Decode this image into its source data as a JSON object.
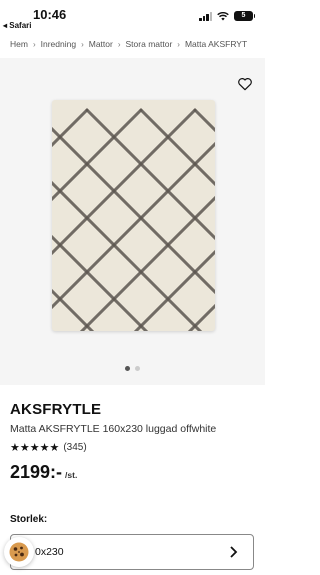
{
  "status_bar": {
    "time": "10:46",
    "back_app": "◂ Safari",
    "battery": "5"
  },
  "breadcrumb": [
    "Hem",
    "Inredning",
    "Mattor",
    "Stora mattor",
    "Matta AKSFRYT"
  ],
  "product": {
    "name": "AKSFRYTLE",
    "description": "Matta AKSFRYTLE 160x230 luggad offwhite",
    "stars": "★★★★★",
    "rating_value": 5,
    "review_count": "(345)",
    "price": "2199:-",
    "price_unit": "/st."
  },
  "gallery": {
    "image_count": 2,
    "active_index": 0
  },
  "size": {
    "label": "Storlek:",
    "selected": "0x230"
  },
  "colors": {
    "rug_background": "#ece7da",
    "rug_pattern": "#5c5650",
    "image_area_background": "#f5f5f5"
  }
}
